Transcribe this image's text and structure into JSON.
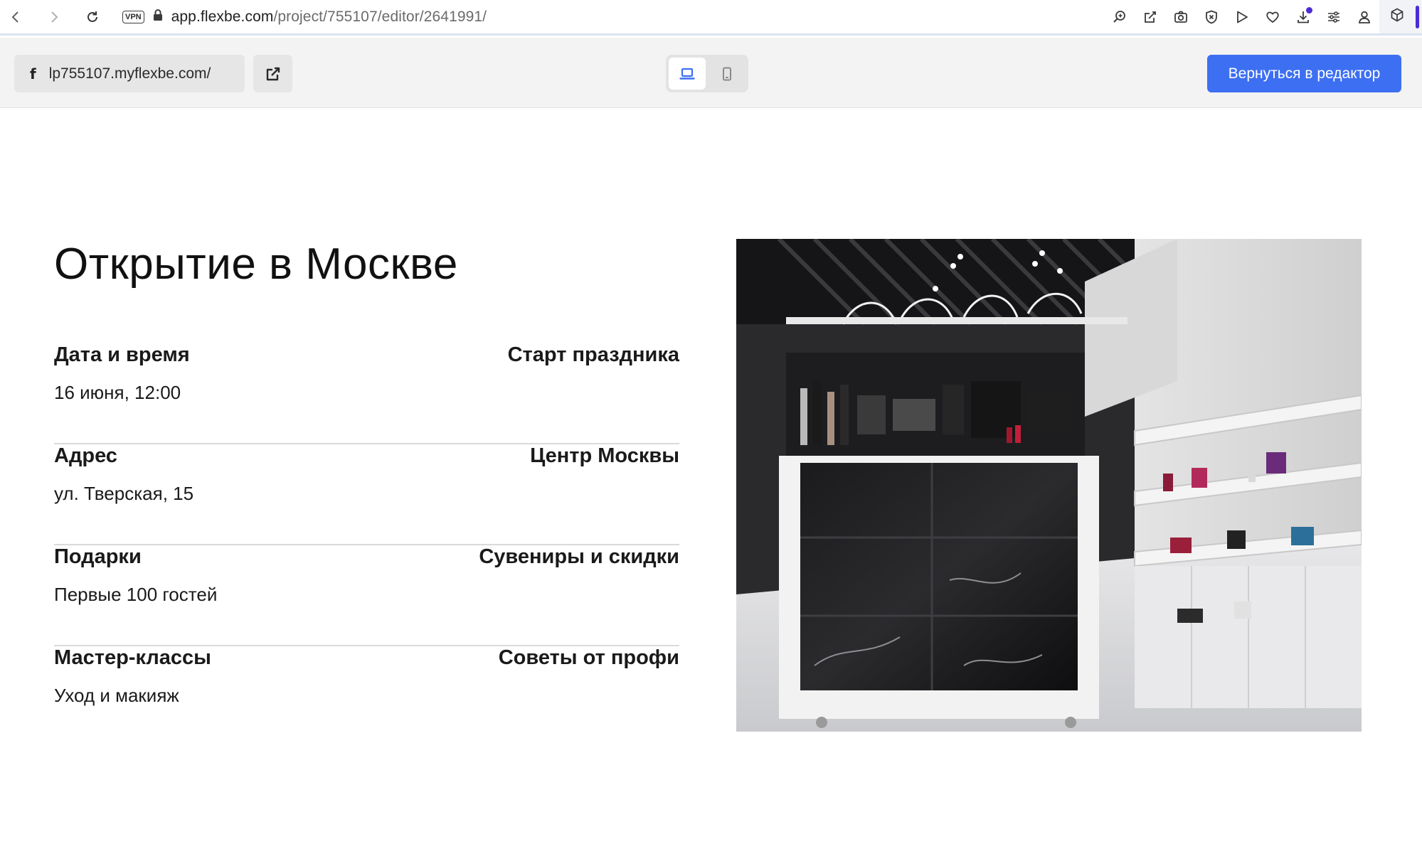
{
  "browser": {
    "vpn_label": "VPN",
    "url_host": "app.flexbe.com",
    "url_path": "/project/755107/editor/2641991/"
  },
  "preview_bar": {
    "site_url": "lp755107.myflexbe.com/",
    "logo_glyph": "f",
    "back_button": "Вернуться в редактор",
    "active_device": "desktop"
  },
  "event": {
    "title": "Открытие в Москве",
    "rows": [
      {
        "label": "Дата и время",
        "value": "16 июня, 12:00",
        "right": "Старт праздника"
      },
      {
        "label": "Адрес",
        "value": "ул. Тверская, 15",
        "right": "Центр Москвы"
      },
      {
        "label": "Подарки",
        "value": "Первые 100 гостей",
        "right": "Сувениры и скидки"
      },
      {
        "label": "Мастер-классы",
        "value": "Уход и макияж",
        "right": "Советы от профи"
      }
    ]
  },
  "colors": {
    "accent": "#3d6ff2",
    "extension_accent": "#4b2bd6"
  }
}
